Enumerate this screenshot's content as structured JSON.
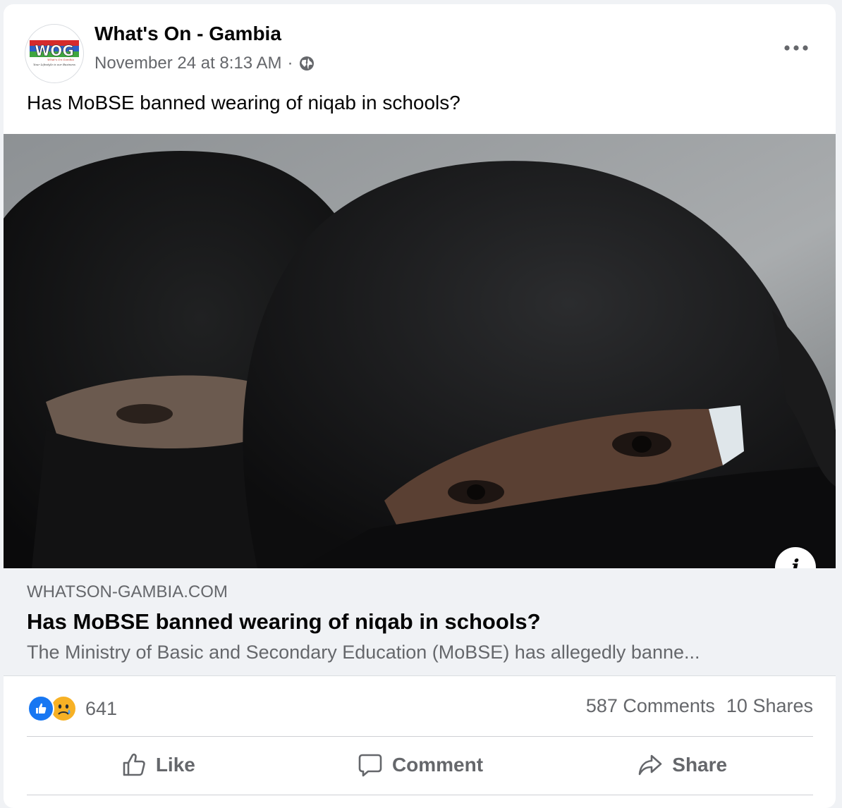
{
  "post": {
    "page_name": "What's On - Gambia",
    "timestamp": "November 24 at 8:13 AM",
    "separator": "·",
    "audience_icon": "globe-icon",
    "text": "Has MoBSE banned wearing of niqab in schools?"
  },
  "avatar": {
    "logo_letters": "WOG",
    "logo_script": "What's On Gambia",
    "tagline": "Your Lifestyle is our Business"
  },
  "link": {
    "domain": "WHATSON-GAMBIA.COM",
    "title": "Has MoBSE banned wearing of niqab in schools?",
    "description": "The Ministry of Basic and Secondary Education (MoBSE) has allegedly banne...",
    "info_glyph": "i"
  },
  "stats": {
    "reaction_icons": [
      "like-icon",
      "sad-icon"
    ],
    "reaction_count": "641",
    "comments": "587 Comments",
    "shares": "10 Shares"
  },
  "actions": {
    "like": "Like",
    "comment": "Comment",
    "share": "Share"
  },
  "colors": {
    "accent": "#1877f2",
    "secondary_text": "#65676b",
    "sad_reaction": "#f7b125"
  }
}
